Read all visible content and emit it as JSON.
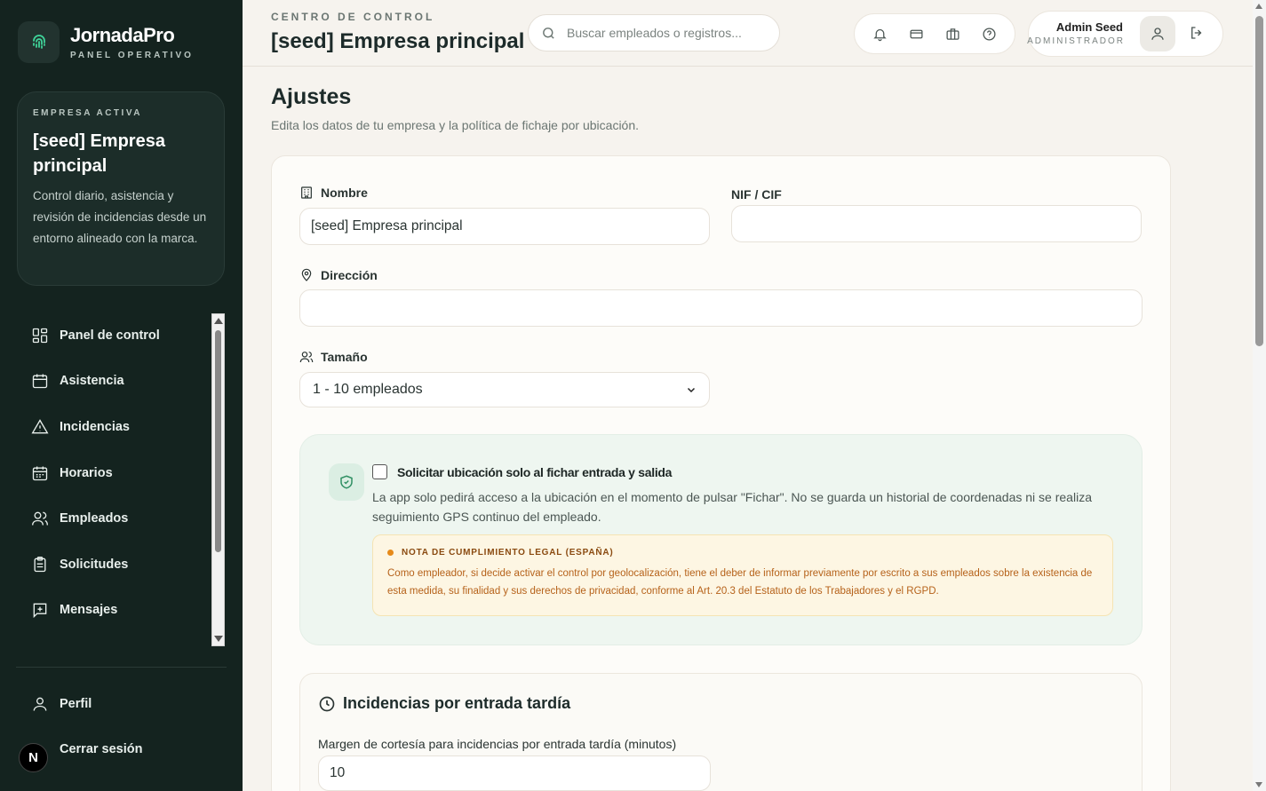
{
  "brand": {
    "name": "JornadaPro",
    "subtitle": "PANEL OPERATIVO"
  },
  "company_card": {
    "kicker": "EMPRESA ACTIVA",
    "name": "[seed] Empresa principal",
    "description": "Control diario, asistencia y revisión de incidencias desde un entorno alineado con la marca."
  },
  "nav": {
    "items": [
      {
        "label": "Panel de control",
        "icon": "dashboard-icon"
      },
      {
        "label": "Asistencia",
        "icon": "calendar-icon"
      },
      {
        "label": "Incidencias",
        "icon": "warning-icon"
      },
      {
        "label": "Horarios",
        "icon": "schedule-icon"
      },
      {
        "label": "Empleados",
        "icon": "users-icon"
      },
      {
        "label": "Solicitudes",
        "icon": "clipboard-icon"
      },
      {
        "label": "Mensajes",
        "icon": "message-icon"
      }
    ],
    "footer": {
      "profile": "Perfil",
      "logout": "Cerrar sesión",
      "avatar_letter": "N"
    }
  },
  "header": {
    "kicker": "CENTRO DE CONTROL",
    "title": "[seed] Empresa principal",
    "search_placeholder": "Buscar empleados o registros...",
    "icons": [
      "bell-icon",
      "card-icon",
      "briefcase-icon",
      "help-icon"
    ],
    "user": {
      "name": "Admin Seed",
      "role": "ADMINISTRADOR"
    }
  },
  "page": {
    "title": "Ajustes",
    "subtitle": "Edita los datos de tu empresa y la política de fichaje por ubicación."
  },
  "form": {
    "nombre_label": "Nombre",
    "nombre_value": "[seed] Empresa principal",
    "nif_label": "NIF / CIF",
    "nif_value": "",
    "direccion_label": "Dirección",
    "direccion_value": "",
    "tamano_label": "Tamaño",
    "tamano_value": "1 - 10 empleados"
  },
  "geo": {
    "checkbox_checked": false,
    "title": "Solicitar ubicación solo al fichar entrada y salida",
    "description": "La app solo pedirá acceso a la ubicación en el momento de pulsar \"Fichar\". No se guarda un historial de coordenadas ni se realiza seguimiento GPS continuo del empleado.",
    "legal_title": "NOTA DE CUMPLIMIENTO LEGAL (ESPAÑA)",
    "legal_text": "Como empleador, si decide activar el control por geolocalización, tiene el deber de informar previamente por escrito a sus empleados sobre la existencia de esta medida, su finalidad y sus derechos de privacidad, conforme al Art. 20.3 del Estatuto de los Trabajadores y el RGPD."
  },
  "late": {
    "title": "Incidencias por entrada tardía",
    "margin_label": "Margen de cortesía para incidencias por entrada tardía (minutos)",
    "margin_value": "10"
  }
}
